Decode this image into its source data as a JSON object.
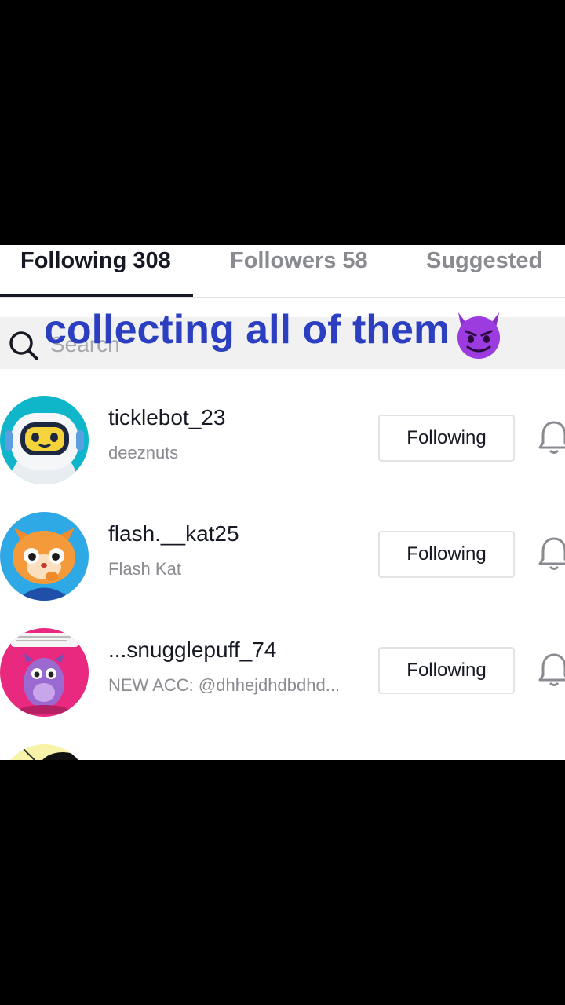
{
  "tabs": [
    {
      "label": "Following 308",
      "active": true
    },
    {
      "label": "Followers 58",
      "active": false
    },
    {
      "label": "Suggested",
      "active": false
    }
  ],
  "search": {
    "placeholder": "Search",
    "icon": "search-icon"
  },
  "caption": {
    "text": "collecting all of them",
    "emoji": "smiling-devil-icon"
  },
  "users": [
    {
      "username": "ticklebot_23",
      "nickname": "deeznuts",
      "button": "Following",
      "avatar": "robot-avatar",
      "bell": "bell-icon"
    },
    {
      "username": "flash.__kat25",
      "nickname": "Flash Kat",
      "button": "Following",
      "avatar": "cat-avatar",
      "bell": "bell-icon"
    },
    {
      "username": "...snugglepuff_74",
      "nickname": "NEW ACC: @dhhejdhdbdhd...",
      "button": "Following",
      "avatar": "monster-avatar",
      "bell": "bell-icon"
    }
  ],
  "colors": {
    "caption": "#2b3fc0",
    "text": "#161823",
    "muted": "#8a8b91",
    "background": "#000000"
  }
}
